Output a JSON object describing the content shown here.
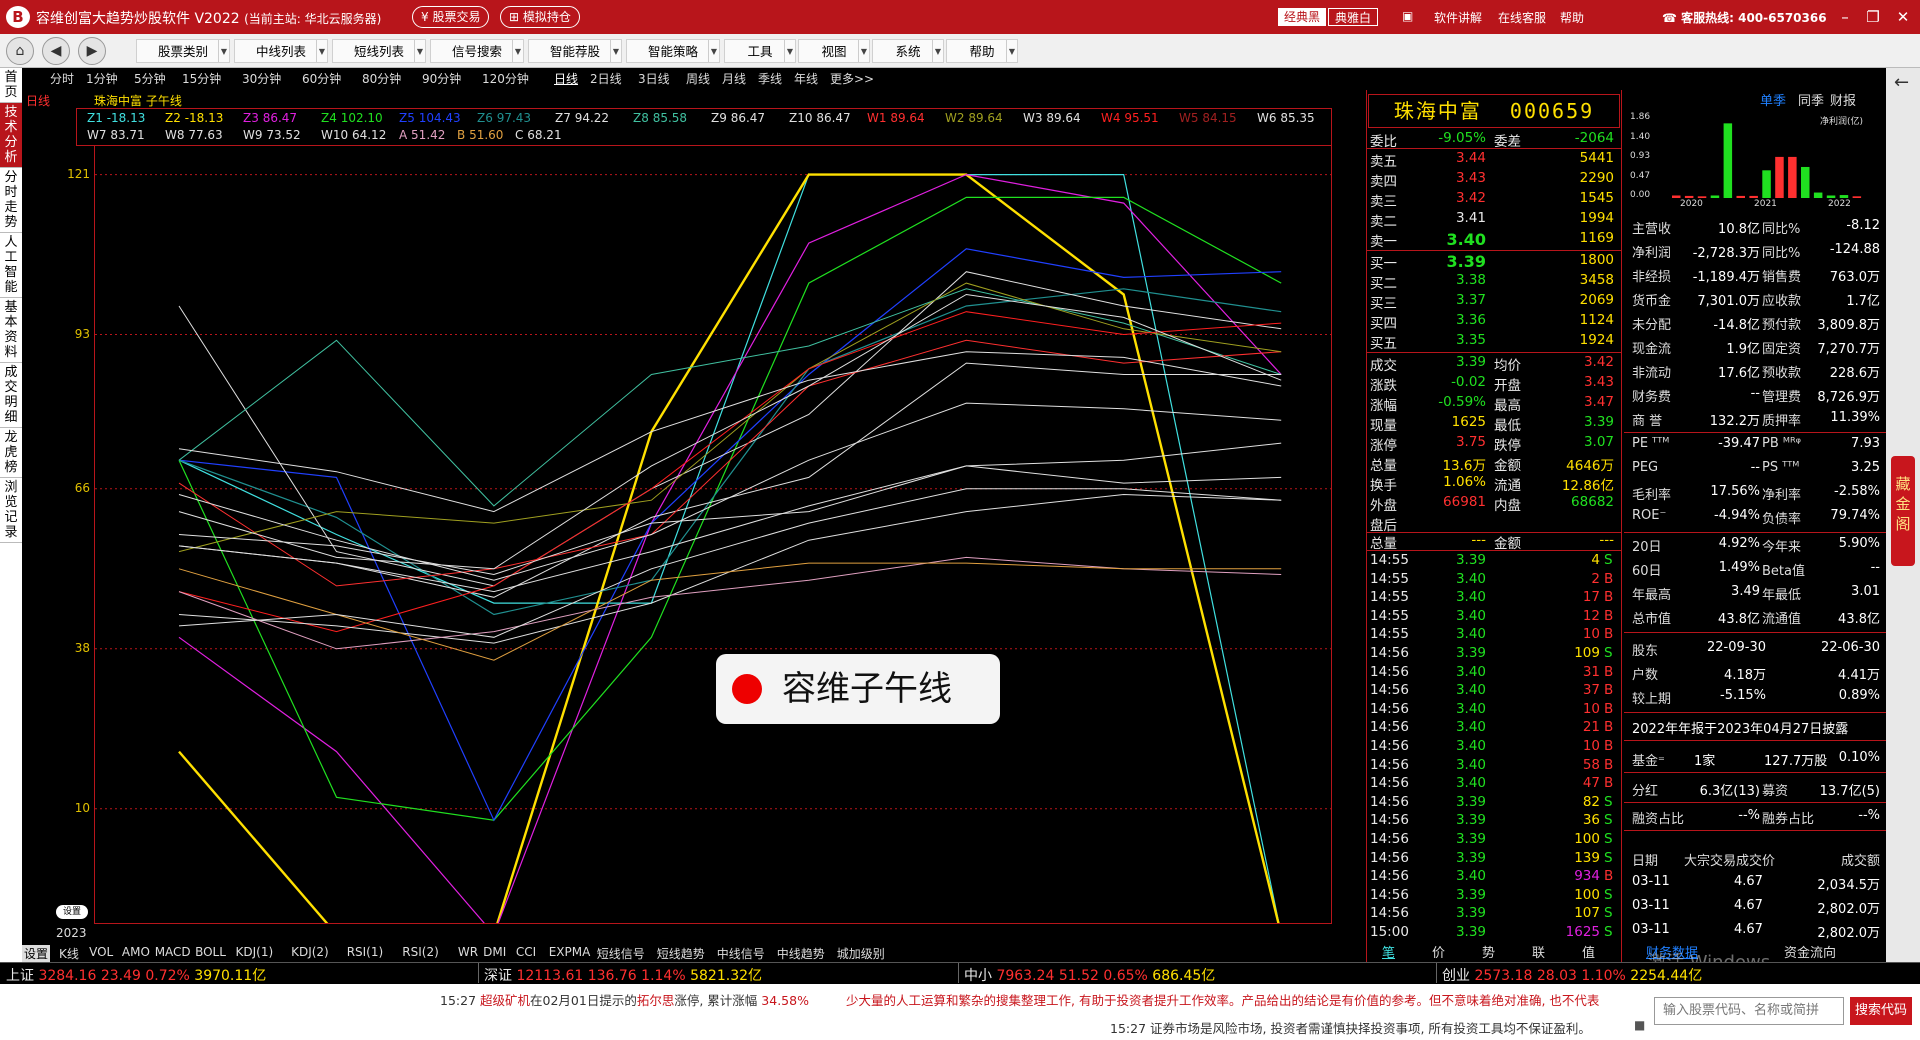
{
  "window": {
    "logo": "B",
    "title": "容维创富大趋势炒股软件 V2022",
    "server": "(当前主站: 华北云服务器)",
    "btn_trade": "股票交易",
    "btn_sim": "模拟持仓",
    "skin_black": "经典黑",
    "skin_elegant": "典雅白",
    "link_tutorial": "软件讲解",
    "link_service": "在线客服",
    "link_help": "帮助",
    "hotline": "客服热线: 400-6570366"
  },
  "toolbar": {
    "menus": [
      "股票类别",
      "中线列表",
      "短线列表",
      "信号搜索",
      "智能荐股",
      "智能策略",
      "工具",
      "视图",
      "系统",
      "帮助"
    ]
  },
  "left_tabs": [
    "首页",
    "日线",
    "技术分析",
    "分时走势",
    "人工智能",
    "基本资料",
    "成交明细",
    "龙虎榜",
    "浏览记录"
  ],
  "periods": [
    "分时",
    "1分钟",
    "5分钟",
    "15分钟",
    "30分钟",
    "60分钟",
    "80分钟",
    "90分钟",
    "120分钟",
    "日线",
    "2日线",
    "3日线",
    "周线",
    "月线",
    "季线",
    "年线",
    "更多>>"
  ],
  "chart_header": "珠海中富 子午线",
  "chart_data": {
    "type": "line",
    "title": "珠海中富 子午线",
    "x_start_label": "2023",
    "ylim": [
      -10,
      126
    ],
    "y_ticks": [
      121,
      93,
      66,
      38,
      10
    ],
    "legend_row1": [
      {
        "name": "Z1",
        "value": "-18.13",
        "color": "#40e0e0"
      },
      {
        "name": "Z2",
        "value": "-18.13",
        "color": "#ffe000"
      },
      {
        "name": "Z3",
        "value": "86.47",
        "color": "#e020e0"
      },
      {
        "name": "Z4",
        "value": "102.10",
        "color": "#20e020"
      },
      {
        "name": "Z5",
        "value": "104.43",
        "color": "#2040ff"
      },
      {
        "name": "Z6",
        "value": "97.43",
        "color": "#209090"
      },
      {
        "name": "Z7",
        "value": "94.22",
        "color": "#e0e0e0"
      },
      {
        "name": "Z8",
        "value": "85.58",
        "color": "#40c0a0"
      },
      {
        "name": "Z9",
        "value": "86.47",
        "color": "#e0e0e0"
      },
      {
        "name": "Z10",
        "value": "86.47",
        "color": "#e0e0e0"
      },
      {
        "name": "W1",
        "value": "89.64",
        "color": "#ff3030"
      },
      {
        "name": "W2",
        "value": "89.64",
        "color": "#a0a020"
      },
      {
        "name": "W3",
        "value": "89.64",
        "color": "#e0e0e0"
      },
      {
        "name": "W4",
        "value": "95.51",
        "color": "#ff2020"
      },
      {
        "name": "W5",
        "value": "84.15",
        "color": "#a02020"
      },
      {
        "name": "W6",
        "value": "85.35",
        "color": "#e0e0e0"
      }
    ],
    "legend_row2": [
      {
        "name": "W7",
        "value": "83.71",
        "color": "#e0e0e0"
      },
      {
        "name": "W8",
        "value": "77.63",
        "color": "#e0e0e0"
      },
      {
        "name": "W9",
        "value": "73.52",
        "color": "#e0e0e0"
      },
      {
        "name": "W10",
        "value": "64.12",
        "color": "#e0e0e0"
      },
      {
        "name": "A",
        "value": "51.42",
        "color": "#e0a0c0"
      },
      {
        "name": "B",
        "value": "51.60",
        "color": "#e0a040"
      },
      {
        "name": "C",
        "value": "68.21",
        "color": "#e0e0e0"
      }
    ],
    "series": [
      {
        "name": "Z1",
        "color": "#40e0e0",
        "width": 1.2,
        "values": [
          null,
          71,
          58,
          46,
          46,
          121,
          121,
          121,
          -12,
          -12
        ]
      },
      {
        "name": "Z2",
        "color": "#ffe000",
        "width": 2.4,
        "values": [
          null,
          20,
          -12,
          -12,
          76,
          121,
          121,
          100,
          -12,
          null
        ]
      },
      {
        "name": "Z3",
        "color": "#e020e0",
        "width": 1.2,
        "values": [
          null,
          40,
          20,
          -12,
          60,
          109,
          121,
          116,
          86,
          null
        ]
      },
      {
        "name": "Z4",
        "color": "#20e020",
        "width": 1.2,
        "values": [
          null,
          71,
          12,
          8,
          40,
          102,
          117,
          117,
          102,
          null
        ]
      },
      {
        "name": "Z5",
        "color": "#2040ff",
        "width": 1.2,
        "values": [
          null,
          71,
          68,
          8,
          60,
          86,
          108,
          103,
          104,
          null
        ]
      },
      {
        "name": "Z6",
        "color": "#209090",
        "width": 1.2,
        "values": [
          null,
          71,
          61,
          44,
          50,
          87,
          98,
          101,
          97,
          null
        ]
      },
      {
        "name": "Z7",
        "color": "#e0e0e0",
        "width": 1,
        "values": [
          null,
          98,
          55,
          49,
          66,
          79,
          104,
          98,
          94,
          null
        ]
      },
      {
        "name": "Z8",
        "color": "#40c0a0",
        "width": 1,
        "values": [
          null,
          71,
          92,
          63,
          86,
          91,
          101,
          95,
          86,
          null
        ]
      },
      {
        "name": "Z9",
        "color": "#e0e0e0",
        "width": 1,
        "values": [
          null,
          56,
          53,
          47,
          61,
          68,
          88,
          86,
          86,
          null
        ]
      },
      {
        "name": "W1",
        "color": "#ff3030",
        "width": 1,
        "values": [
          null,
          67,
          49,
          52,
          58,
          84,
          92,
          88,
          90,
          null
        ]
      },
      {
        "name": "W2",
        "color": "#a0a020",
        "width": 1,
        "values": [
          null,
          55,
          62,
          60,
          64,
          87,
          102,
          94,
          90,
          null
        ]
      },
      {
        "name": "W4",
        "color": "#ff2020",
        "width": 1,
        "values": [
          null,
          48,
          41,
          49,
          66,
          87,
          97,
          93,
          95,
          null
        ]
      },
      {
        "name": "W6",
        "color": "#e0e0e0",
        "width": 1,
        "values": [
          null,
          62,
          54,
          52,
          70,
          84,
          100,
          96,
          85,
          null
        ]
      },
      {
        "name": "W7",
        "color": "#e0e0e0",
        "width": 1,
        "values": [
          null,
          73,
          69,
          62,
          76,
          85,
          90,
          89,
          84,
          null
        ]
      },
      {
        "name": "W8",
        "color": "#e0e0e0",
        "width": 1,
        "values": [
          null,
          65,
          57,
          50,
          58,
          71,
          81,
          80,
          78,
          null
        ]
      },
      {
        "name": "W9",
        "color": "#e0e0e0",
        "width": 1,
        "values": [
          null,
          56,
          53,
          48,
          55,
          63,
          70,
          71,
          74,
          null
        ]
      },
      {
        "name": "W10",
        "color": "#e0e0e0",
        "width": 1,
        "values": [
          null,
          44,
          42,
          39,
          46,
          57,
          62,
          65,
          64,
          null
        ]
      },
      {
        "name": "A",
        "color": "#e0a0c0",
        "width": 1,
        "values": [
          null,
          48,
          38,
          41,
          47,
          50,
          54,
          52,
          51,
          null
        ]
      },
      {
        "name": "B",
        "color": "#e0a040",
        "width": 1,
        "values": [
          null,
          52,
          44,
          36,
          50,
          53,
          53,
          52,
          52,
          null
        ]
      },
      {
        "name": "C",
        "color": "#e0e0e0",
        "width": 1,
        "values": [
          null,
          58,
          56,
          51,
          60,
          62,
          70,
          67,
          68,
          null
        ]
      },
      {
        "name": "W3",
        "color": "#e0e0e0",
        "width": 1,
        "values": [
          null,
          42,
          44,
          40,
          52,
          60,
          66,
          66,
          64,
          null
        ]
      }
    ]
  },
  "chart_settings_label": "设置",
  "watermark_text": "容维子午线",
  "indicator_tabs": [
    "设置",
    "K线",
    "VOL",
    "AMO",
    "MACD",
    "BOLL",
    "KDJ(1)",
    "KDJ(2)",
    "RSI(1)",
    "RSI(2)",
    "WR",
    "DMI",
    "CCI",
    "EXPMA",
    "短线信号",
    "短线趋势",
    "中线信号",
    "中线趋势",
    "城加级别"
  ],
  "stock": {
    "name": "珠海中富",
    "code": "000659",
    "weibi_label": "委比",
    "weibi": "-9.05%",
    "weicha_label": "委差",
    "weicha": "-2064",
    "sell": [
      {
        "label": "卖五",
        "price": "3.44",
        "vol": "5441"
      },
      {
        "label": "卖四",
        "price": "3.43",
        "vol": "2290"
      },
      {
        "label": "卖三",
        "price": "3.42",
        "vol": "1545"
      },
      {
        "label": "卖二",
        "price": "3.41",
        "vol": "1994"
      },
      {
        "label": "卖一",
        "price": "3.40",
        "vol": "1169"
      }
    ],
    "buy": [
      {
        "label": "买一",
        "price": "3.39",
        "vol": "1800"
      },
      {
        "label": "买二",
        "price": "3.38",
        "vol": "3458"
      },
      {
        "label": "买三",
        "price": "3.37",
        "vol": "2069"
      },
      {
        "label": "买四",
        "price": "3.36",
        "vol": "1124"
      },
      {
        "label": "买五",
        "price": "3.35",
        "vol": "1924"
      }
    ],
    "quote": [
      {
        "l1": "成交",
        "v1": "3.39",
        "c1": "grn",
        "l2": "均价",
        "v2": "3.42",
        "c2": "red"
      },
      {
        "l1": "涨跌",
        "v1": "-0.02",
        "c1": "grn",
        "l2": "开盘",
        "v2": "3.43",
        "c2": "red"
      },
      {
        "l1": "涨幅",
        "v1": "-0.59%",
        "c1": "grn",
        "l2": "最高",
        "v2": "3.47",
        "c2": "red"
      },
      {
        "l1": "现量",
        "v1": "1625",
        "c1": "yel",
        "l2": "最低",
        "v2": "3.39",
        "c2": "grn"
      },
      {
        "l1": "涨停",
        "v1": "3.75",
        "c1": "red",
        "l2": "跌停",
        "v2": "3.07",
        "c2": "grn"
      },
      {
        "l1": "总量",
        "v1": "13.6万",
        "c1": "yel",
        "l2": "金额",
        "v2": "4646万",
        "c2": "yel"
      },
      {
        "l1": "换手",
        "v1": "1.06%",
        "c1": "yel",
        "l2": "流通",
        "v2": "12.86亿",
        "c2": "yel"
      },
      {
        "l1": "外盘",
        "v1": "66981",
        "c1": "red",
        "l2": "内盘",
        "v2": "68682",
        "c2": "grn"
      }
    ],
    "after_label": "盘后",
    "after_total_label": "总量",
    "after_total": "---",
    "after_amount_label": "金额",
    "after_amount": "---"
  },
  "ticks": [
    {
      "time": "14:55",
      "price": "3.39",
      "pc": "grn",
      "vol": "4",
      "vc": "yel",
      "bs": "S",
      "bc": "grn"
    },
    {
      "time": "14:55",
      "price": "3.40",
      "pc": "grn",
      "vol": "2",
      "vc": "red",
      "bs": "B",
      "bc": "red"
    },
    {
      "time": "14:55",
      "price": "3.40",
      "pc": "grn",
      "vol": "17",
      "vc": "red",
      "bs": "B",
      "bc": "red"
    },
    {
      "time": "14:55",
      "price": "3.40",
      "pc": "grn",
      "vol": "12",
      "vc": "red",
      "bs": "B",
      "bc": "red"
    },
    {
      "time": "14:55",
      "price": "3.40",
      "pc": "grn",
      "vol": "10",
      "vc": "red",
      "bs": "B",
      "bc": "red"
    },
    {
      "time": "14:56",
      "price": "3.39",
      "pc": "grn",
      "vol": "109",
      "vc": "yel",
      "bs": "S",
      "bc": "grn"
    },
    {
      "time": "14:56",
      "price": "3.40",
      "pc": "grn",
      "vol": "31",
      "vc": "red",
      "bs": "B",
      "bc": "red"
    },
    {
      "time": "14:56",
      "price": "3.40",
      "pc": "grn",
      "vol": "37",
      "vc": "red",
      "bs": "B",
      "bc": "red"
    },
    {
      "time": "14:56",
      "price": "3.40",
      "pc": "grn",
      "vol": "10",
      "vc": "red",
      "bs": "B",
      "bc": "red"
    },
    {
      "time": "14:56",
      "price": "3.40",
      "pc": "grn",
      "vol": "21",
      "vc": "red",
      "bs": "B",
      "bc": "red"
    },
    {
      "time": "14:56",
      "price": "3.40",
      "pc": "grn",
      "vol": "10",
      "vc": "red",
      "bs": "B",
      "bc": "red"
    },
    {
      "time": "14:56",
      "price": "3.40",
      "pc": "grn",
      "vol": "58",
      "vc": "red",
      "bs": "B",
      "bc": "red"
    },
    {
      "time": "14:56",
      "price": "3.40",
      "pc": "grn",
      "vol": "47",
      "vc": "red",
      "bs": "B",
      "bc": "red"
    },
    {
      "time": "14:56",
      "price": "3.39",
      "pc": "grn",
      "vol": "82",
      "vc": "yel",
      "bs": "S",
      "bc": "grn"
    },
    {
      "time": "14:56",
      "price": "3.39",
      "pc": "grn",
      "vol": "36",
      "vc": "yel",
      "bs": "S",
      "bc": "grn"
    },
    {
      "time": "14:56",
      "price": "3.39",
      "pc": "grn",
      "vol": "100",
      "vc": "yel",
      "bs": "S",
      "bc": "grn"
    },
    {
      "time": "14:56",
      "price": "3.39",
      "pc": "grn",
      "vol": "139",
      "vc": "yel",
      "bs": "S",
      "bc": "grn"
    },
    {
      "time": "14:56",
      "price": "3.40",
      "pc": "grn",
      "vol": "934",
      "vc": "mag",
      "bs": "B",
      "bc": "red"
    },
    {
      "time": "14:56",
      "price": "3.39",
      "pc": "grn",
      "vol": "100",
      "vc": "yel",
      "bs": "S",
      "bc": "grn"
    },
    {
      "time": "14:56",
      "price": "3.39",
      "pc": "grn",
      "vol": "107",
      "vc": "yel",
      "bs": "S",
      "bc": "grn"
    },
    {
      "time": "15:00",
      "price": "3.39",
      "pc": "grn",
      "vol": "1625",
      "vc": "mag",
      "bs": "S",
      "bc": "grn"
    }
  ],
  "bottom_tabs": [
    "笔",
    "价",
    "势",
    "联",
    "值"
  ],
  "finance": {
    "tabs": [
      "单季",
      "同季",
      "财报"
    ],
    "mini_chart_unit": "净利润(亿)",
    "mini_chart_yticks": [
      "1.86",
      "1.40",
      "0.93",
      "0.47",
      "0.00"
    ],
    "mini_chart_years": [
      "2020",
      "2021",
      "2022"
    ],
    "mini_chart_bars": [
      {
        "v": 0.06,
        "c": "#ff3030"
      },
      {
        "v": 0.05,
        "c": "#ff3030"
      },
      {
        "v": 0.04,
        "c": "#ff3030"
      },
      {
        "v": 0.06,
        "c": "#20e020"
      },
      {
        "v": 1.78,
        "c": "#20e020"
      },
      {
        "v": 0.05,
        "c": "#ff3030"
      },
      {
        "v": 0.05,
        "c": "#ff3030"
      },
      {
        "v": 0.66,
        "c": "#20e020"
      },
      {
        "v": 0.98,
        "c": "#ff3030"
      },
      {
        "v": 0.98,
        "c": "#ff3030"
      },
      {
        "v": 0.74,
        "c": "#20e020"
      },
      {
        "v": 0.13,
        "c": "#20e020"
      },
      {
        "v": 0.06,
        "c": "#20e020"
      },
      {
        "v": 0.07,
        "c": "#20e020"
      },
      {
        "v": 0.04,
        "c": "#ff3030"
      }
    ],
    "rows": [
      {
        "l1": "主营收",
        "v1": "10.8亿",
        "l2": "同比%",
        "v2": "-8.12"
      },
      {
        "l1": "净利润",
        "v1": "-2,728.3万",
        "l2": "同比%",
        "v2": "-124.88"
      },
      {
        "l1": "非经损",
        "v1": "-1,189.4万",
        "l2": "销售费",
        "v2": "763.0万"
      },
      {
        "l1": "货币金",
        "v1": "7,301.0万",
        "l2": "应收款",
        "v2": "1.7亿"
      },
      {
        "l1": "未分配",
        "v1": "-14.8亿",
        "l2": "预付款",
        "v2": "3,809.8万"
      },
      {
        "l1": "现金流",
        "v1": "1.9亿",
        "l2": "固定资",
        "v2": "7,270.7万"
      },
      {
        "l1": "非流动",
        "v1": "17.6亿",
        "l2": "预收款",
        "v2": "228.6万"
      },
      {
        "l1": "财务费",
        "v1": "--",
        "l2": "管理费",
        "v2": "8,726.9万"
      },
      {
        "l1": "商 誉",
        "v1": "132.2万",
        "l2": "质押率",
        "v2": "11.39%"
      }
    ],
    "rows2": [
      {
        "l1": "PE ᵀᵀᴹ",
        "v1": "-39.47",
        "l2": "PB ᴹᴿᵠ",
        "v2": "7.93"
      },
      {
        "l1": "PEG",
        "v1": "--",
        "l2": "PS ᵀᵀᴹ",
        "v2": "3.25"
      },
      {
        "l1": "毛利率",
        "v1": "17.56%",
        "l2": "净利率",
        "v2": "-2.58%"
      },
      {
        "l1": "ROE⁻",
        "v1": "-4.94%",
        "l2": "负债率",
        "v2": "79.74%"
      }
    ],
    "rows3": [
      {
        "l1": "20日",
        "v1": "4.92%",
        "l2": "今年来",
        "v2": "5.90%"
      },
      {
        "l1": "60日",
        "v1": "1.49%",
        "l2": "Beta值",
        "v2": "--"
      },
      {
        "l1": "年最高",
        "v1": "3.49",
        "l2": "年最低",
        "v2": "3.01"
      },
      {
        "l1": "总市值",
        "v1": "43.8亿",
        "l2": "流通值",
        "v2": "43.8亿"
      }
    ],
    "holders": [
      {
        "l": "股东",
        "v1": "22-09-30",
        "v2": "22-06-30"
      },
      {
        "l": "户数",
        "v1": "4.18万",
        "v2": "4.41万"
      },
      {
        "l": "较上期",
        "v1": "-5.15%",
        "v2": "0.89%"
      }
    ],
    "report_note": "2022年年报于2023年04月27日披露",
    "fund_label": "基金⁼",
    "fund_count": "1家",
    "fund_shares": "127.7万股",
    "fund_pct": "0.10%",
    "div_label": "分红",
    "div_value": "6.3亿(13)",
    "raise_label": "募资",
    "raise_value": "13.7亿(5)",
    "margin_label": "融资占比",
    "margin_value": "--%",
    "short_label": "融券占比",
    "short_value": "--%",
    "block_head": [
      "日期",
      "大宗交易成交价",
      "成交额"
    ],
    "block_rows": [
      {
        "date": "03-11",
        "price": "4.67",
        "amount": "2,034.5万"
      },
      {
        "date": "03-11",
        "price": "4.67",
        "amount": "2,802.0万"
      },
      {
        "date": "03-11",
        "price": "4.67",
        "amount": "2,802.0万"
      }
    ],
    "bottom_tab1": "财务数据",
    "bottom_tab2": "资金流向",
    "activate_line1": "激活 Windows",
    "activate_line2": "转到\"设置\"以激活 Windows。"
  },
  "side_strip": {
    "arrow": "←",
    "label": "藏金阁"
  },
  "indices": [
    {
      "name": "上证",
      "value": "3284.16",
      "change": "23.49",
      "pct": "0.72%",
      "amount": "3970.11亿"
    },
    {
      "name": "深证",
      "value": "12113.61",
      "change": "136.76",
      "pct": "1.14%",
      "amount": "5821.32亿"
    },
    {
      "name": "中小",
      "value": "7963.24",
      "change": "51.52",
      "pct": "0.65%",
      "amount": "686.45亿"
    },
    {
      "name": "创业",
      "value": "2573.18",
      "change": "28.03",
      "pct": "1.10%",
      "amount": "2254.44亿"
    }
  ],
  "news": {
    "time1": "15:27",
    "stock1": "超级矿机",
    "text1a": "在02月01日提示的",
    "stock2": "拓尔思",
    "text1b": "涨停, 累计涨幅",
    "gain": "34.58%",
    "ticker": "少大量的人工运算和繁杂的搜集整理工作, 有助于投资者提升工作效率。产品给出的结论是有价值的参考。但不意味着绝对准确, 也不代表",
    "time2": "15:27",
    "text2": "证券市场是风险市场, 投资者需谨慎抉择投资事项, 所有投资工具均不保证盈利。"
  },
  "search": {
    "placeholder": "输入股票代码、名称或简拼",
    "button": "搜索代码"
  }
}
